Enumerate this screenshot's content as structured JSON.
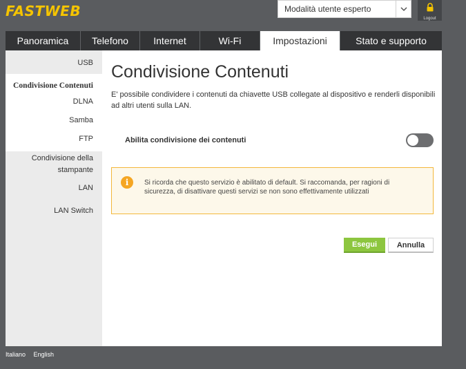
{
  "header": {
    "logo_text": "FASTWEB",
    "mode_select_value": "Modalità utente esperto",
    "logout_label": "Logout"
  },
  "nav": {
    "tabs": [
      {
        "label": "Panoramica",
        "active": false
      },
      {
        "label": "Telefono",
        "active": false
      },
      {
        "label": "Internet",
        "active": false
      },
      {
        "label": "Wi-Fi",
        "active": false
      },
      {
        "label": "Impostazioni",
        "active": true
      },
      {
        "label": "Stato e supporto",
        "active": false
      }
    ]
  },
  "sidebar": {
    "items": [
      {
        "label": "USB"
      },
      {
        "label": "Condivisione Contenuti"
      },
      {
        "label": "DLNA"
      },
      {
        "label": "Samba"
      },
      {
        "label": "FTP"
      },
      {
        "label": "Condivisione della"
      },
      {
        "label": "stampante"
      },
      {
        "label": "LAN"
      },
      {
        "label": "LAN Switch"
      }
    ]
  },
  "main": {
    "title": "Condivisione Contenuti",
    "description": "E' possibile condividere i contenuti da chiavette USB collegate al dispositivo e renderli disponibili ad altri utenti sulla LAN.",
    "toggle_label": "Abilita condivisione dei contenuti",
    "toggle_on": false,
    "alert_text": "Si ricorda che questo servizio è abilitato di default. Si raccomanda, per ragioni di sicurezza, di disattivare questi servizi se non sono effettivamente utilizzati",
    "run_button": "Esegui",
    "cancel_button": "Annulla"
  },
  "footer": {
    "languages": [
      "Italiano",
      "English"
    ]
  },
  "colors": {
    "brand_yellow": "#f5c400",
    "accent_green": "#8dc63f",
    "alert_border": "#f3b73a",
    "nav_bg": "#333436"
  }
}
